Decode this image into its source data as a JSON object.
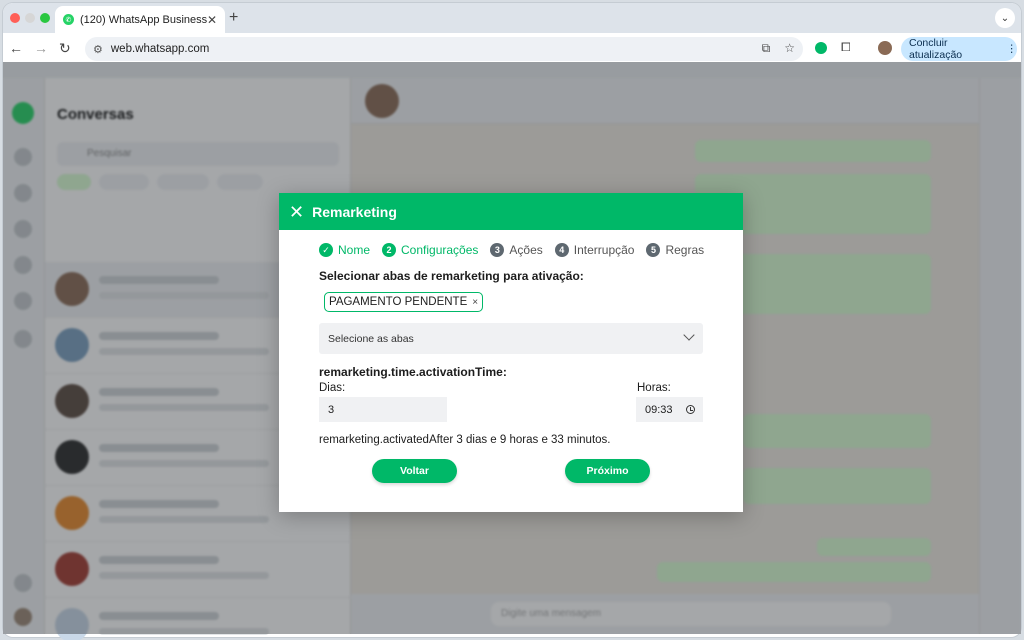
{
  "browser": {
    "tab_title": "(120) WhatsApp Business",
    "url": "web.whatsapp.com",
    "update_button": "Concluir atualização"
  },
  "whatsapp": {
    "sidebar_title": "Conversas",
    "search_placeholder": "Pesquisar",
    "message_placeholder": "Digite uma mensagem"
  },
  "modal": {
    "title": "Remarketing",
    "steps": [
      {
        "number": "✓",
        "label": "Nome",
        "state": "done"
      },
      {
        "number": "2",
        "label": "Configurações",
        "state": "active"
      },
      {
        "number": "3",
        "label": "Ações",
        "state": "pending"
      },
      {
        "number": "4",
        "label": "Interrupção",
        "state": "pending"
      },
      {
        "number": "5",
        "label": "Regras",
        "state": "pending"
      }
    ],
    "tabs_label": "Selecionar abas de remarketing para ativação:",
    "selected_tag": "PAGAMENTO PENDENTE",
    "select_placeholder": "Selecione as abas",
    "activation_time_label": "remarketing.time.activationTime:",
    "days_label": "Dias:",
    "days_value": "3",
    "hours_label": "Horas:",
    "hours_value": "09:33",
    "summary": "remarketing.activatedAfter 3 dias e 9 horas e 33 minutos.",
    "back_button": "Voltar",
    "next_button": "Próximo"
  },
  "colors": {
    "accent": "#00b868",
    "pending_step": "#5e6870"
  }
}
